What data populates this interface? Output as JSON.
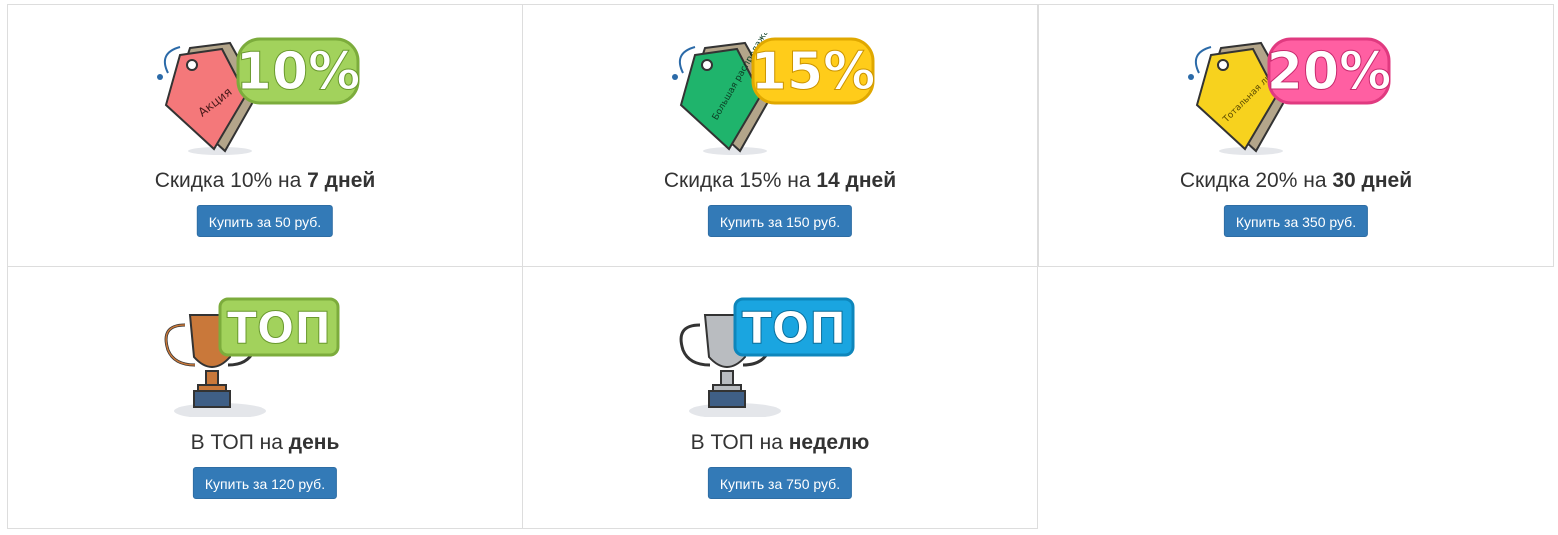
{
  "offers": [
    {
      "caption_prefix": "Скидка 10% на ",
      "caption_bold": "7 дней",
      "button_label": "Купить за 50 руб.",
      "badge_text": "10%",
      "tag_text": "Акция",
      "tag_color": "#f4787a",
      "badge_color": "#a2d25c",
      "icon": "sale-tag-icon"
    },
    {
      "caption_prefix": "Скидка 15% на ",
      "caption_bold": "14 дней",
      "button_label": "Купить за 150 руб.",
      "badge_text": "15%",
      "tag_text": "Большая распродажа",
      "tag_color": "#1fb46c",
      "badge_color": "#ffcc1a",
      "icon": "sale-tag-icon"
    },
    {
      "caption_prefix": "Скидка 20% на ",
      "caption_bold": "30 дней",
      "button_label": "Купить за 350 руб.",
      "badge_text": "20%",
      "tag_text": "Тотальная ликвидация",
      "tag_color": "#f7d21e",
      "badge_color": "#ff5fa2",
      "icon": "sale-tag-icon"
    },
    {
      "caption_prefix": "В ТОП на ",
      "caption_bold": "день",
      "button_label": "Купить за 120 руб.",
      "badge_text": "ТОП",
      "badge_color": "#a2d25c",
      "trophy_color": "#c9783a",
      "icon": "trophy-icon"
    },
    {
      "caption_prefix": "В ТОП на ",
      "caption_bold": "неделю",
      "button_label": "Купить за 750 руб.",
      "badge_text": "ТОП",
      "badge_color": "#1aa5e0",
      "trophy_color": "#b9bcc0",
      "icon": "trophy-icon"
    }
  ],
  "button_color": "#337ab7"
}
